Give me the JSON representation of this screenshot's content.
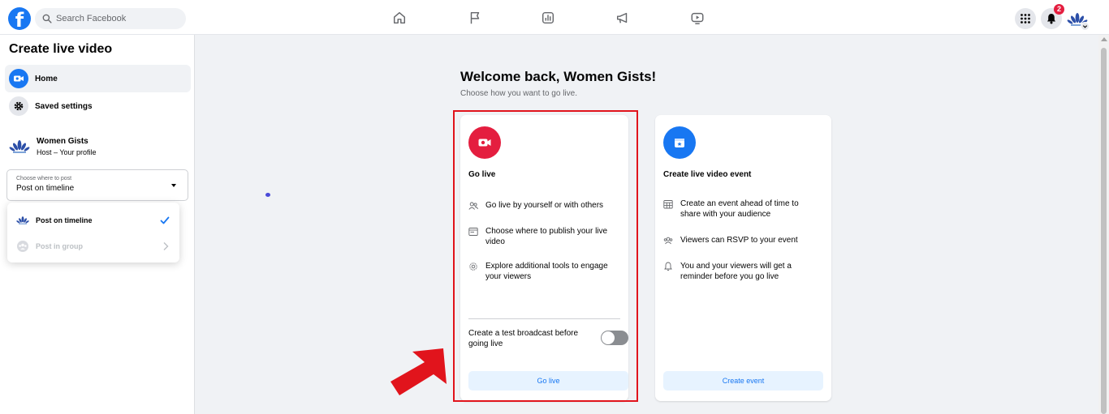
{
  "topbar": {
    "logo": "f",
    "search_placeholder": "Search Facebook",
    "notification_count": "2",
    "nav_icons": [
      "home-icon",
      "flag-icon",
      "chart-icon",
      "megaphone-icon",
      "video-icon"
    ]
  },
  "sidebar": {
    "title": "Create live video",
    "items": [
      {
        "label": "Home",
        "icon": "live-camera-icon",
        "active": true
      },
      {
        "label": "Saved settings",
        "icon": "gear-icon",
        "active": false
      }
    ],
    "profile": {
      "name": "Women Gists",
      "subtitle": "Host – Your profile"
    },
    "post_select": {
      "label": "Choose where to post",
      "value": "Post on timeline"
    },
    "dropdown": [
      {
        "label": "Post on timeline",
        "selected": true,
        "enabled": true
      },
      {
        "label": "Post in group",
        "selected": false,
        "enabled": false
      }
    ]
  },
  "main": {
    "welcome": "Welcome back, Women Gists!",
    "subtitle": "Choose how you want to go live.",
    "go_live_card": {
      "title": "Go live",
      "icon_color": "#e41e3f",
      "features": [
        "Go live by yourself or with others",
        "Choose where to publish your live video",
        "Explore additional tools to engage your viewers"
      ],
      "toggle_label": "Create a test broadcast before going live",
      "toggle_on": false,
      "button": "Go live"
    },
    "event_card": {
      "title": "Create live video event",
      "icon_color": "#1877f2",
      "features": [
        "Create an event ahead of time to share with your audience",
        "Viewers can RSVP to your event",
        "You and your viewers will get a reminder before you go live"
      ],
      "button": "Create event"
    }
  },
  "colors": {
    "accent": "#1877f2",
    "highlight": "#e1141c"
  }
}
